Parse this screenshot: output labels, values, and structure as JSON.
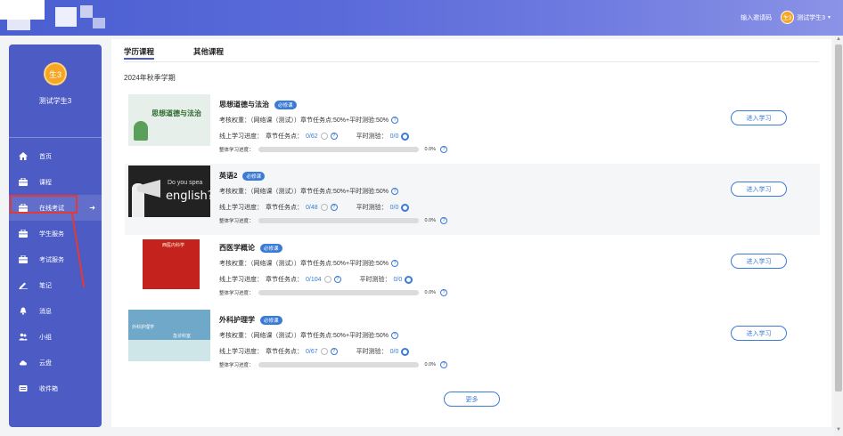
{
  "header": {
    "invite_code_label": "输入邀请码",
    "user_avatar_text": "生3",
    "user_name": "测试学生3"
  },
  "sidebar": {
    "avatar_text": "生3",
    "user_name": "测试学生3",
    "items": [
      {
        "label": "首页",
        "icon": "home-icon"
      },
      {
        "label": "课程",
        "icon": "briefcase-icon"
      },
      {
        "label": "在线考试",
        "icon": "briefcase-icon",
        "active": true
      },
      {
        "label": "学生服务",
        "icon": "briefcase-icon"
      },
      {
        "label": "考试服务",
        "icon": "briefcase-icon"
      },
      {
        "label": "笔记",
        "icon": "pen-icon"
      },
      {
        "label": "消息",
        "icon": "bell-icon"
      },
      {
        "label": "小组",
        "icon": "group-icon"
      },
      {
        "label": "云盘",
        "icon": "cloud-icon"
      },
      {
        "label": "收件箱",
        "icon": "inbox-icon"
      }
    ]
  },
  "tabs": [
    {
      "label": "学历课程",
      "active": true
    },
    {
      "label": "其他课程",
      "active": false
    }
  ],
  "semester": "2024年秋季学期",
  "common": {
    "badge": "必修课",
    "weight_text": "考核权重：（网络课（测试））章节任务点:50%+平时测验:50%",
    "progress_label": "线上学习进度：",
    "chapter_label": "章节任务点：",
    "quiz_label": "平时测验：",
    "overall_label": "整体学习进度：",
    "enter_label": "进入学习",
    "more_label": "更多"
  },
  "courses": [
    {
      "title": "思想道德与法治",
      "chapter_progress": "0/62",
      "quiz_progress": "0/0",
      "overall_pct": "0.0%",
      "overall_fraction": 0.0,
      "thumb_text": "思想道德与法治"
    },
    {
      "title": "英语2",
      "chapter_progress": "0/48",
      "quiz_progress": "0/0",
      "overall_pct": "0.0%",
      "overall_fraction": 0.0,
      "thumb_text": "Do you spea",
      "thumb_text2": "english?"
    },
    {
      "title": "西医学概论",
      "chapter_progress": "0/104",
      "quiz_progress": "0/0",
      "overall_pct": "0.0%",
      "overall_fraction": 0.0,
      "thumb_text": "西医内科学"
    },
    {
      "title": "外科护理学",
      "chapter_progress": "0/67",
      "quiz_progress": "0/0",
      "overall_pct": "0.0%",
      "overall_fraction": 0.0,
      "thumb_text": "外科护理学",
      "thumb_text2": "急诊科室"
    }
  ],
  "colors": {
    "accent": "#3a7bd5",
    "sidebar": "#4c5cc4",
    "highlight": "#e53935"
  }
}
